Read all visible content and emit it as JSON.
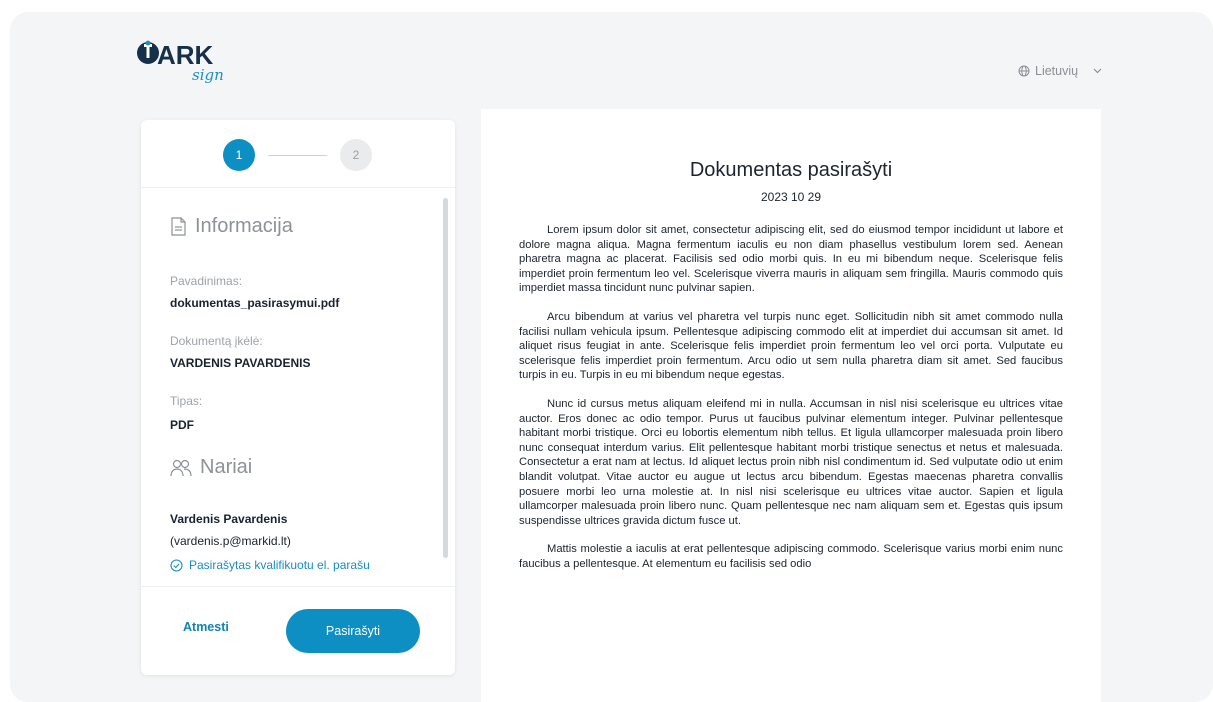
{
  "brand": {
    "logo_text": "ARK",
    "logo_sub": "sign"
  },
  "language": {
    "label": "Lietuvių",
    "globe_icon": "globe-icon",
    "chevron_icon": "chevron-down-icon"
  },
  "steps": {
    "step1": "1",
    "step2": "2",
    "active": 1
  },
  "info": {
    "title": "Informacija",
    "name_label": "Pavadinimas:",
    "name_value": "dokumentas_pasirasymui.pdf",
    "uploader_label": "Dokumentą įkėlė:",
    "uploader_value": "VARDENIS PAVARDENIS",
    "type_label": "Tipas:",
    "type_value": "PDF"
  },
  "members": {
    "title": "Nariai",
    "items": [
      {
        "name": "Vardenis Pavardenis",
        "email": "(vardenis.p@markid.lt)",
        "status": "Pasirašytas kvalifikuotu el. parašu"
      }
    ]
  },
  "actions": {
    "reject": "Atmesti",
    "sign": "Pasirašyti"
  },
  "document": {
    "title": "Dokumentas pasirašyti",
    "date": "2023 10 29",
    "paragraphs": [
      "Lorem ipsum dolor sit amet, consectetur adipiscing elit, sed do eiusmod tempor incididunt ut labore et dolore magna aliqua. Magna fermentum iaculis eu non diam phasellus vestibulum lorem sed. Aenean pharetra magna ac placerat. Facilisis sed odio morbi quis. In eu mi bibendum neque. Scelerisque felis imperdiet proin fermentum leo vel. Scelerisque viverra mauris in aliquam sem fringilla. Mauris commodo quis imperdiet massa tincidunt nunc pulvinar sapien.",
      "Arcu bibendum at varius vel pharetra vel turpis nunc eget. Sollicitudin nibh sit amet commodo nulla facilisi nullam vehicula ipsum. Pellentesque adipiscing commodo elit at imperdiet dui accumsan sit amet. Id aliquet risus feugiat in ante. Scelerisque felis imperdiet proin fermentum leo vel orci porta. Vulputate eu scelerisque felis imperdiet proin fermentum. Arcu odio ut sem nulla pharetra diam sit amet. Sed faucibus turpis in eu. Turpis in eu mi bibendum neque egestas.",
      "Nunc id cursus metus aliquam eleifend mi in nulla. Accumsan in nisl nisi scelerisque eu ultrices vitae auctor. Eros donec ac odio tempor. Purus ut faucibus pulvinar elementum integer. Pulvinar pellentesque habitant morbi tristique. Orci eu lobortis elementum nibh tellus. Et ligula ullamcorper malesuada proin libero nunc consequat interdum varius. Elit pellentesque habitant morbi tristique senectus et netus et malesuada. Consectetur a erat nam at lectus. Id aliquet lectus proin nibh nisl condimentum id. Sed vulputate odio ut enim blandit volutpat. Vitae auctor eu augue ut lectus arcu bibendum. Egestas maecenas pharetra convallis posuere morbi leo urna molestie at. In nisl nisi scelerisque eu ultrices vitae auctor. Sapien et ligula ullamcorper malesuada proin libero nunc. Quam pellentesque nec nam aliquam sem et. Egestas quis ipsum suspendisse ultrices gravida dictum fusce ut.",
      "Mattis molestie a iaculis at erat pellentesque adipiscing commodo. Scelerisque varius morbi enim nunc faucibus a pellentesque. At elementum eu facilisis sed odio"
    ]
  },
  "colors": {
    "accent": "#0e8fc4",
    "brand_dark": "#17304a",
    "background": "#f4f5f7"
  }
}
